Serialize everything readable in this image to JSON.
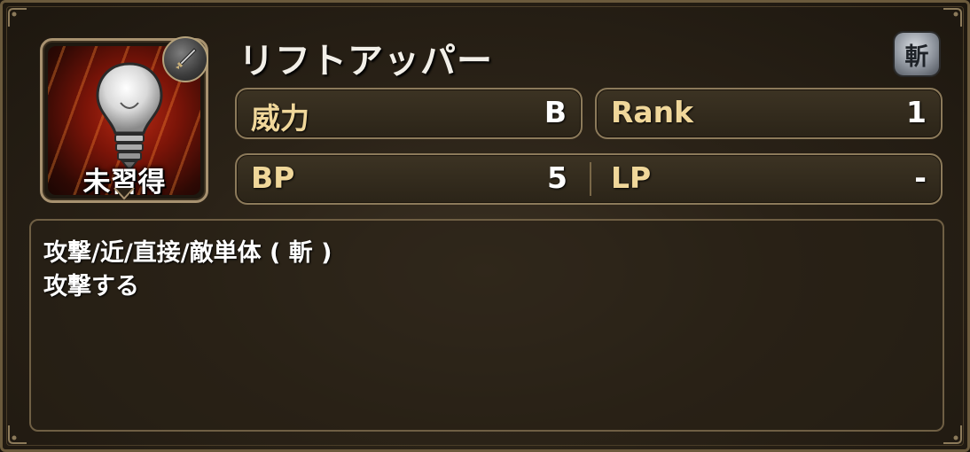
{
  "skill": {
    "name": "リフトアッパー",
    "status": "未習得",
    "type_badge": "斬",
    "icon": "lightbulb-icon",
    "weapon_icon": "sword-icon"
  },
  "stats": {
    "power_label": "威力",
    "power_value": "B",
    "rank_label": "Rank",
    "rank_value": "1",
    "bp_label": "BP",
    "bp_value": "5",
    "lp_label": "LP",
    "lp_value": "-"
  },
  "description": {
    "line1": "攻撃/近/直接/敵単体 ( 斬 )",
    "line2": "攻撃する"
  },
  "colors": {
    "label_gold": "#f0d79a",
    "frame_gold": "#8c7a5a",
    "icon_red": "#b82a14"
  }
}
